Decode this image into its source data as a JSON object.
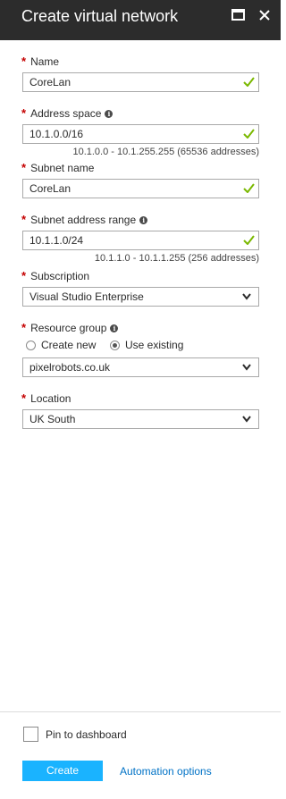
{
  "header": {
    "title": "Create virtual network",
    "maximize_icon": "maximize-icon",
    "close_icon": "close-icon"
  },
  "colors": {
    "header_bg": "#2c2c2c",
    "required": "#c40000",
    "check": "#7ab800",
    "create_button": "#1ab3ff",
    "link": "#0072c6"
  },
  "form": {
    "name": {
      "label": "Name",
      "value": "CoreLan"
    },
    "address_space": {
      "label": "Address space",
      "value": "10.1.0.0/16",
      "hint": "10.1.0.0 - 10.1.255.255 (65536 addresses)"
    },
    "subnet_name": {
      "label": "Subnet name",
      "value": "CoreLan"
    },
    "subnet_range": {
      "label": "Subnet address range",
      "value": "10.1.1.0/24",
      "hint": "10.1.1.0 - 10.1.1.255 (256 addresses)"
    },
    "subscription": {
      "label": "Subscription",
      "value": "Visual Studio Enterprise"
    },
    "resource_group": {
      "label": "Resource group",
      "option_new": "Create new",
      "option_existing": "Use existing",
      "selected": "Use existing",
      "value": "pixelrobots.co.uk"
    },
    "location": {
      "label": "Location",
      "value": "UK South"
    },
    "required_marker": "*",
    "info_glyph": "i"
  },
  "footer": {
    "pin_label": "Pin to dashboard",
    "pin_checked": false,
    "create_label": "Create",
    "automation_label": "Automation options"
  }
}
